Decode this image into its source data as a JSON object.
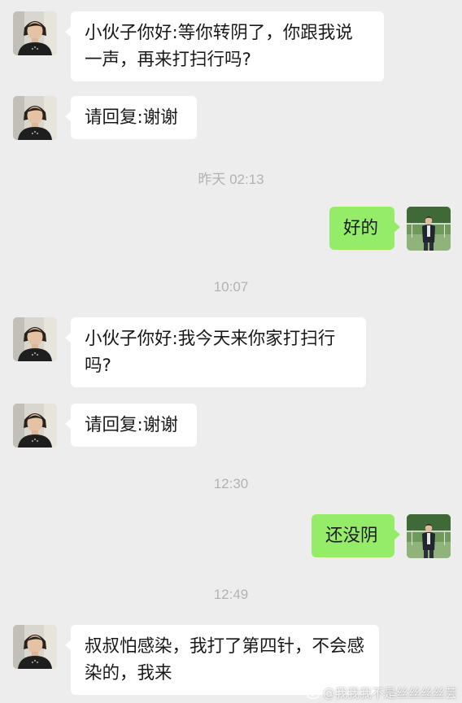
{
  "messages": [
    {
      "type": "in",
      "text": "小伙子你好:等你转阴了，你跟我说一声，再来打扫行吗?"
    },
    {
      "type": "in",
      "text": "请回复:谢谢"
    },
    {
      "type": "time",
      "text": "昨天 02:13"
    },
    {
      "type": "out",
      "text": "好的"
    },
    {
      "type": "time",
      "text": "10:07"
    },
    {
      "type": "in",
      "text": "小伙子你好:我今天来你家打扫行吗?"
    },
    {
      "type": "in",
      "text": "请回复:谢谢"
    },
    {
      "type": "time",
      "text": "12:30"
    },
    {
      "type": "out",
      "text": "还没阴"
    },
    {
      "type": "time",
      "text": "12:49"
    },
    {
      "type": "in",
      "text": "叔叔怕感染，我打了第四针，不会感染的，我来"
    }
  ],
  "watermark": "@我我我不是丝丝丝丝芸",
  "colors": {
    "background": "#ededed",
    "incoming_bubble": "#ffffff",
    "outgoing_bubble": "#95ec69",
    "timestamp": "#b2b2b2"
  }
}
